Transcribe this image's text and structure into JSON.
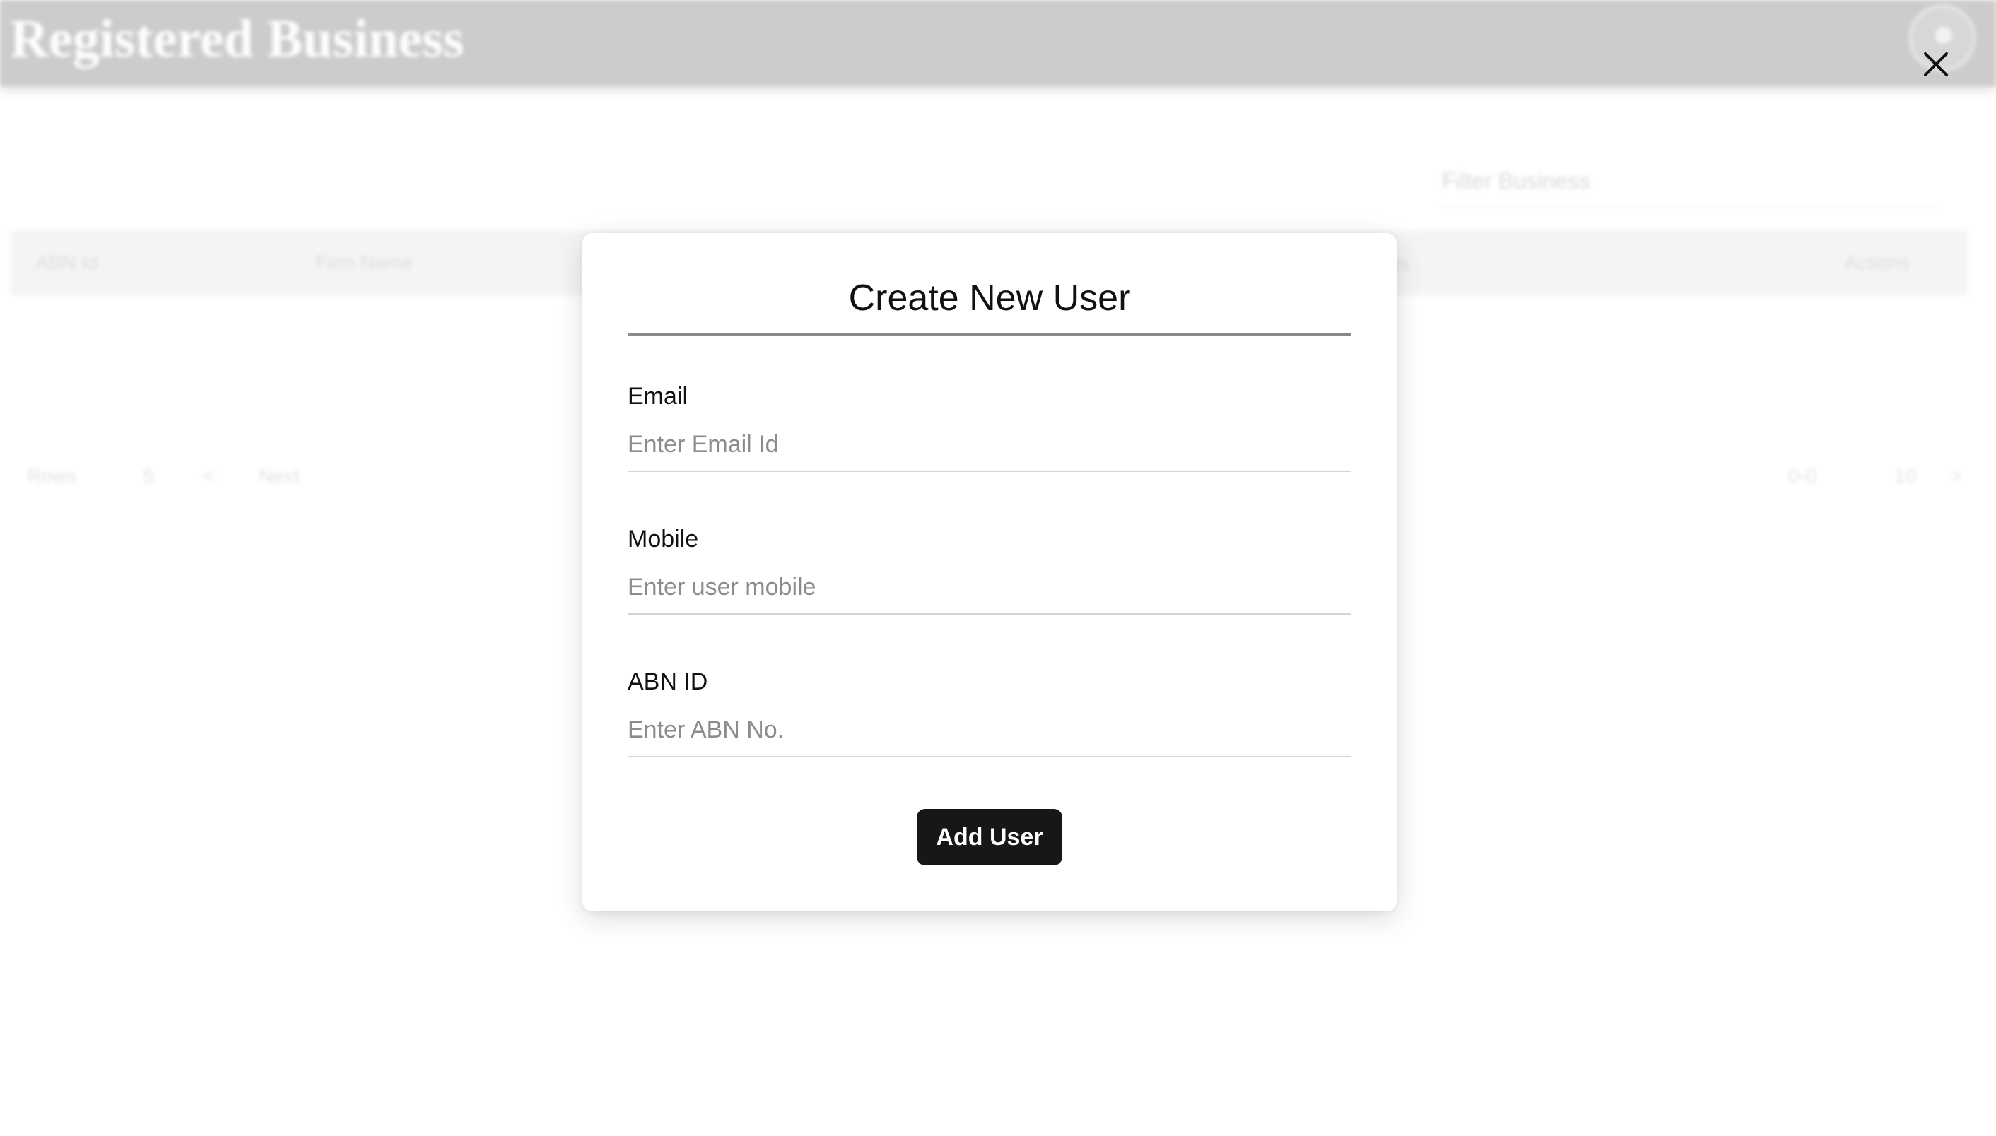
{
  "background": {
    "app_title": "Registered Business",
    "filter_placeholder": "Filter Business",
    "table_columns": [
      "ABN Id",
      "Firm Name",
      "Status",
      "Actions"
    ],
    "pager": {
      "rows_label": "Rows",
      "rows_value": "5",
      "prev": "<",
      "next": "Next",
      "range": "0-0",
      "total": "10",
      "last": ">"
    }
  },
  "modal": {
    "title": "Create New User",
    "fields": [
      {
        "label": "Email",
        "placeholder": "Enter Email Id"
      },
      {
        "label": "Mobile",
        "placeholder": "Enter user mobile"
      },
      {
        "label": "ABN ID",
        "placeholder": "Enter ABN No."
      }
    ],
    "submit_label": "Add User"
  },
  "icons": {
    "close": "close-icon",
    "avatar": "avatar"
  }
}
